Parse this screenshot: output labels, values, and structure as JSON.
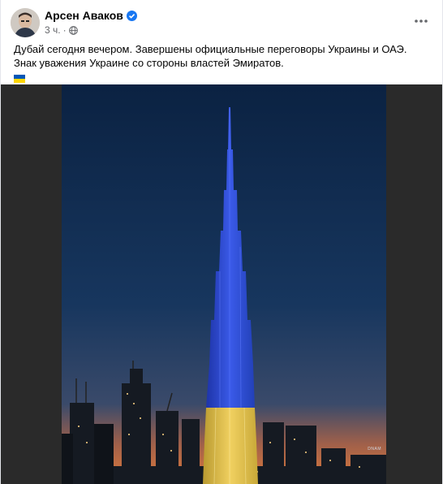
{
  "post": {
    "author": "Арсен Аваков",
    "time": "3 ч.",
    "separator": "·",
    "text_line1": "Дубай сегодня вечером. Завершены официальные переговоры Украины и ОАЭ.",
    "text_line2": "Знак уважения Украине со стороны властей Эмиратов.",
    "flag_emoji": "ukraine-flag",
    "icons": {
      "verified": "verified-badge-icon",
      "privacy": "globe-icon",
      "more": "more-options-icon"
    },
    "colors": {
      "verified": "#1877f2",
      "flag_blue": "#0057b7",
      "flag_yellow": "#ffd700",
      "tower_blue": "#2f4fd6",
      "tower_yellow": "#e8c84a"
    },
    "photo": {
      "description_icon": "burj-khalifa-photo",
      "watermark": "DNAM"
    }
  }
}
